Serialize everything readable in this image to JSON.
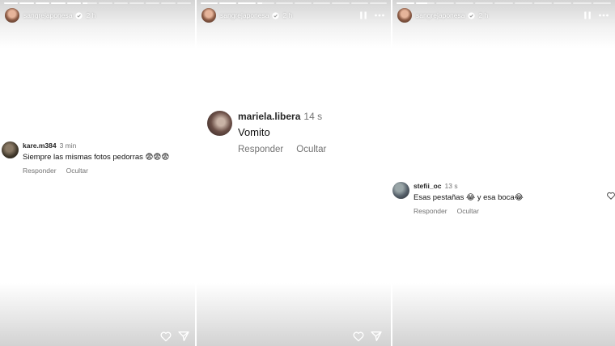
{
  "panels": [
    {
      "account": {
        "username": "sangrejaponesa",
        "time": "2 h"
      },
      "progress": [
        1,
        1,
        1,
        1,
        1,
        0.35,
        0,
        0,
        0,
        0,
        0,
        0
      ],
      "comment": {
        "username": "kare.m384",
        "time": "3 min",
        "text": "Siempre las mismas fotos pedorras",
        "emojis": "😨😨😨",
        "reply_label": "Responder",
        "hide_label": "Ocultar"
      }
    },
    {
      "account": {
        "username": "sangrejaponesa",
        "time": "2 h"
      },
      "progress": [
        1,
        1,
        1,
        0.3,
        0,
        0,
        0,
        0,
        0,
        0
      ],
      "comment": {
        "username": "mariela.libera",
        "time": "14 s",
        "text": "Vomito",
        "reply_label": "Responder",
        "hide_label": "Ocultar"
      }
    },
    {
      "account": {
        "username": "sangrejaponesa",
        "time": "2 h"
      },
      "progress": [
        1,
        0.6,
        0,
        0,
        0,
        0,
        0,
        0,
        0,
        0,
        0
      ],
      "comment": {
        "username": "stefii_oc",
        "time": "13 s",
        "text_a": "Esas pestañas",
        "emoji_a": "😂",
        "text_b": "y esa boca",
        "emoji_b": "😂",
        "reply_label": "Responder",
        "hide_label": "Ocultar"
      }
    }
  ],
  "icons": {
    "verified": "verified-badge-icon",
    "pause": "pause-icon",
    "more": "more-options-icon",
    "heart": "heart-icon",
    "share": "send-icon"
  }
}
